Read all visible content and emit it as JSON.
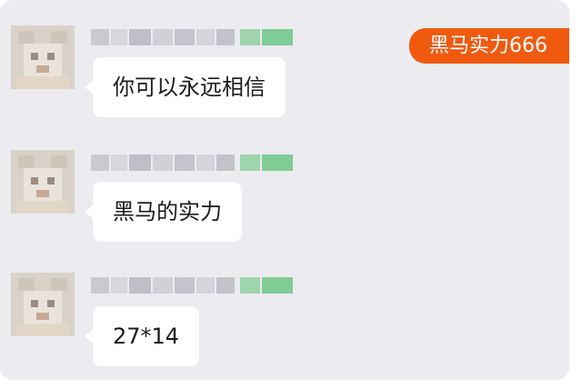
{
  "badge": {
    "text": "黑马实力666"
  },
  "messages": [
    {
      "sender": "",
      "text": "你可以永远相信"
    },
    {
      "sender": "",
      "text": "黑马的实力"
    },
    {
      "sender": "",
      "text": "27*14"
    }
  ],
  "colors": {
    "background": "#ebebf0",
    "bubble": "#ffffff",
    "badge": "#ef5a0f"
  }
}
